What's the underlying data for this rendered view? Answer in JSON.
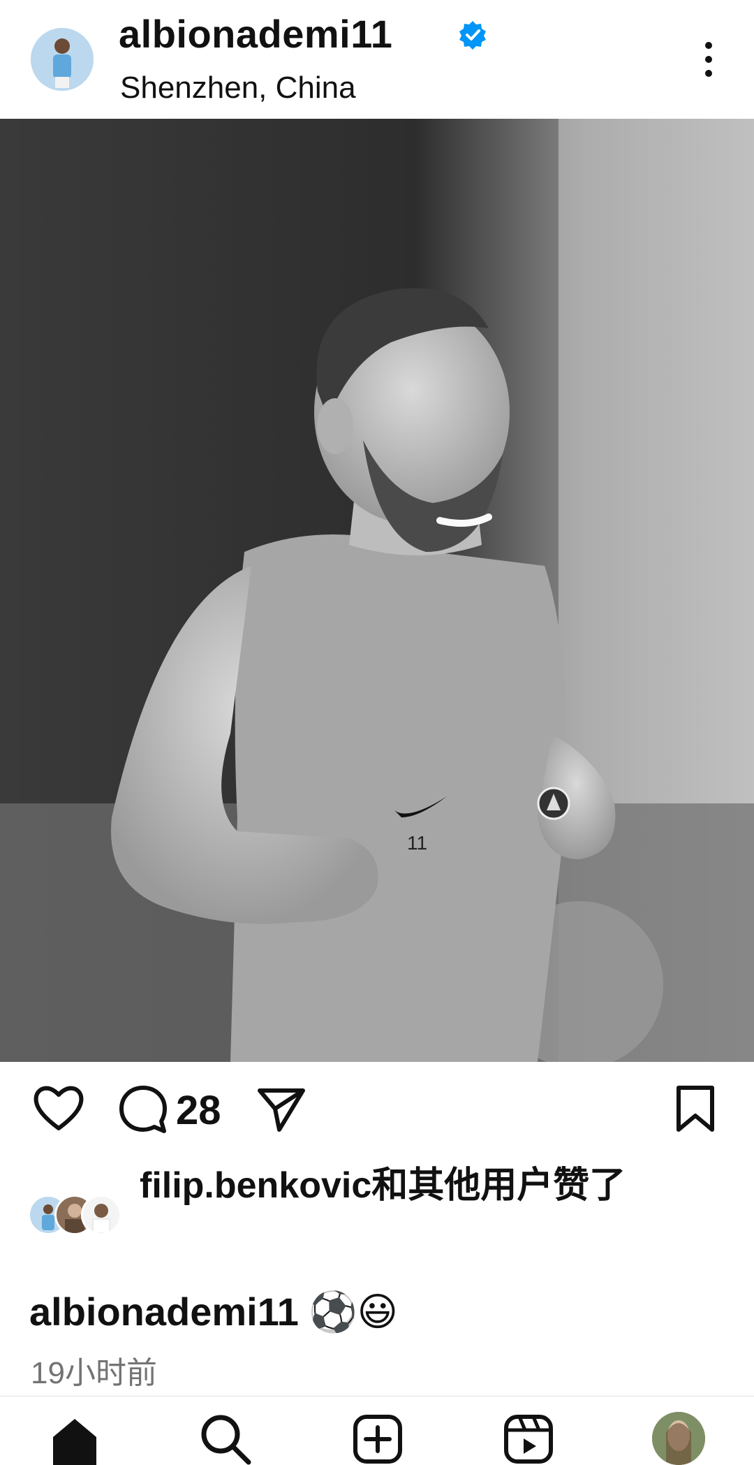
{
  "header": {
    "username": "albionademi11",
    "location": "Shenzhen, China",
    "avatar_icon": "profile-avatar",
    "verified_icon": "verified-badge-icon",
    "more_icon": "more-vertical-icon"
  },
  "post": {
    "image_description_icon": "photo-of-player-running",
    "actions": {
      "like_icon": "heart-icon",
      "comment_icon": "comment-icon",
      "comment_count": "28",
      "share_icon": "send-icon",
      "save_icon": "bookmark-icon"
    },
    "likes_text": "filip.benkovic和其他用户赞了",
    "caption_user": "albionademi11",
    "caption_text": "⚽😃",
    "time_ago": "19小时前"
  },
  "bottom_nav": {
    "items": [
      "home-icon",
      "search-icon",
      "create-icon",
      "reels-icon",
      "profile-icon"
    ]
  },
  "colors": {
    "verified": "#0095f6",
    "text": "#111111",
    "muted": "#737373"
  }
}
